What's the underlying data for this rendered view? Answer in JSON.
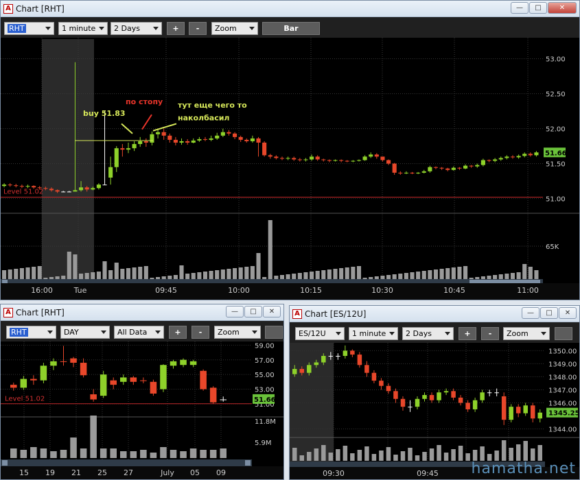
{
  "main": {
    "title": "Chart [RHT]",
    "symbol": "RHT",
    "interval": "1 minute",
    "range": "2 Days",
    "zoom": "Zoom",
    "chart_type_button": "Bar",
    "plus": "+",
    "minus": "-",
    "annotations": {
      "buy": "buy  51.83",
      "stop": "по стопу",
      "note_line1": "тут еще чего то",
      "note_line2": "наколбасил"
    },
    "price_labels": [
      "53.00",
      "52.50",
      "52.00",
      "51.50",
      "51.00"
    ],
    "last_price": "51.66",
    "volume_label": "65K",
    "level_label": "Level 51.02",
    "time_labels": [
      "16:00",
      "Tue",
      "09:45",
      "10:00",
      "10:15",
      "10:30",
      "10:45",
      "11:00"
    ]
  },
  "daily": {
    "title": "Chart [RHT]",
    "symbol": "RHT",
    "interval": "DAY",
    "range": "All Data",
    "zoom": "Zoom",
    "plus": "+",
    "minus": "-",
    "price_labels": [
      "59.00",
      "57.00",
      "55.00",
      "53.00",
      "51.00"
    ],
    "last_price": "51.66",
    "volume_labels": [
      "11.8M",
      "5.9M"
    ],
    "level_label": "Level 51.02",
    "date_labels": [
      "15",
      "19",
      "21",
      "25",
      "27",
      "July",
      "05",
      "09"
    ]
  },
  "es": {
    "title": "Chart [ES/12U]",
    "symbol": "ES/12U",
    "interval": "1 minute",
    "range": "2 Days",
    "zoom": "Zoom",
    "plus": "+",
    "minus": "-",
    "price_labels": [
      "1350.00",
      "1349.00",
      "1348.00",
      "1347.00",
      "1346.00",
      "1344.00"
    ],
    "last_price": "1345.25",
    "time_labels": [
      "09:30",
      "09:45"
    ]
  },
  "watermark": "hamatha.net",
  "chart_data": [
    {
      "type": "candlestick",
      "name": "RHT 1 minute",
      "ylim": [
        50.8,
        53.3
      ],
      "x_labels": [
        "16:00",
        "Tue",
        "09:45",
        "10:00",
        "10:15",
        "10:30",
        "10:45",
        "11:00"
      ],
      "level": 51.02,
      "candles": [
        [
          51.18,
          51.2,
          51.22,
          51.16
        ],
        [
          51.2,
          51.19,
          51.22,
          51.17
        ],
        [
          51.19,
          51.18,
          51.21,
          51.16
        ],
        [
          51.18,
          51.17,
          51.2,
          51.15
        ],
        [
          51.17,
          51.18,
          51.2,
          51.15
        ],
        [
          51.18,
          51.16,
          51.19,
          51.14
        ],
        [
          51.16,
          51.15,
          51.18,
          51.13
        ],
        [
          51.15,
          51.14,
          51.17,
          51.12
        ],
        [
          51.14,
          51.12,
          51.16,
          51.1
        ],
        [
          51.12,
          51.1,
          51.13,
          51.08
        ],
        [
          51.1,
          51.1,
          51.11,
          51.09
        ],
        [
          51.1,
          51.1,
          51.11,
          51.09
        ],
        [
          51.1,
          51.12,
          52.95,
          51.1
        ],
        [
          51.12,
          51.16,
          51.25,
          51.1
        ],
        [
          51.16,
          51.13,
          51.18,
          51.1
        ],
        [
          51.13,
          51.15,
          51.17,
          51.12
        ],
        [
          51.15,
          51.2,
          51.22,
          51.13
        ],
        [
          51.2,
          51.2,
          52.25,
          51.2
        ],
        [
          51.3,
          51.45,
          51.6,
          51.2
        ],
        [
          51.45,
          51.72,
          51.75,
          51.38
        ],
        [
          51.72,
          51.7,
          51.78,
          51.6
        ],
        [
          51.7,
          51.72,
          51.8,
          51.65
        ],
        [
          51.72,
          51.78,
          51.82,
          51.68
        ],
        [
          51.78,
          51.82,
          51.88,
          51.74
        ],
        [
          51.82,
          51.8,
          51.86,
          51.74
        ],
        [
          51.8,
          51.92,
          51.96,
          51.76
        ],
        [
          51.92,
          51.95,
          52.0,
          51.86
        ],
        [
          51.95,
          51.9,
          52.0,
          51.84
        ],
        [
          51.9,
          51.84,
          51.93,
          51.8
        ],
        [
          51.84,
          51.8,
          51.88,
          51.76
        ],
        [
          51.8,
          51.82,
          51.86,
          51.77
        ],
        [
          51.82,
          51.8,
          51.85,
          51.77
        ],
        [
          51.8,
          51.83,
          51.86,
          51.79
        ],
        [
          51.83,
          51.85,
          51.88,
          51.81
        ],
        [
          51.85,
          51.84,
          51.88,
          51.82
        ],
        [
          51.84,
          51.86,
          51.9,
          51.82
        ],
        [
          51.86,
          51.9,
          51.94,
          51.84
        ],
        [
          51.9,
          51.95,
          52.0,
          51.88
        ],
        [
          51.95,
          51.93,
          51.98,
          51.9
        ],
        [
          51.93,
          51.88,
          51.95,
          51.85
        ],
        [
          51.88,
          51.84,
          51.9,
          51.81
        ],
        [
          51.84,
          51.82,
          51.86,
          51.8
        ],
        [
          51.82,
          51.86,
          51.9,
          51.8
        ],
        [
          51.86,
          51.8,
          51.88,
          51.6
        ],
        [
          51.8,
          51.62,
          51.82,
          51.6
        ],
        [
          51.62,
          51.6,
          51.64,
          51.57
        ],
        [
          51.6,
          51.58,
          51.62,
          51.56
        ],
        [
          51.58,
          51.57,
          51.6,
          51.55
        ],
        [
          51.57,
          51.58,
          51.6,
          51.55
        ],
        [
          51.58,
          51.56,
          51.6,
          51.54
        ],
        [
          51.56,
          51.55,
          51.58,
          51.53
        ],
        [
          51.55,
          51.56,
          51.58,
          51.53
        ],
        [
          51.56,
          51.6,
          51.63,
          51.54
        ],
        [
          51.6,
          51.56,
          51.62,
          51.54
        ],
        [
          51.56,
          51.55,
          51.57,
          51.53
        ],
        [
          51.55,
          51.54,
          51.56,
          51.52
        ],
        [
          51.54,
          51.55,
          51.56,
          51.53
        ],
        [
          51.55,
          51.54,
          51.56,
          51.52
        ],
        [
          51.54,
          51.53,
          51.55,
          51.52
        ],
        [
          51.53,
          51.54,
          51.55,
          51.52
        ],
        [
          51.54,
          51.55,
          51.56,
          51.53
        ],
        [
          51.55,
          51.6,
          51.62,
          51.54
        ],
        [
          51.6,
          51.63,
          51.66,
          51.58
        ],
        [
          51.63,
          51.6,
          51.65,
          51.57
        ],
        [
          51.6,
          51.55,
          51.6,
          51.53
        ],
        [
          51.55,
          51.5,
          51.56,
          51.48
        ],
        [
          51.5,
          51.37,
          51.51,
          51.34
        ],
        [
          51.37,
          51.36,
          51.39,
          51.34
        ],
        [
          51.36,
          51.37,
          51.39,
          51.35
        ],
        [
          51.37,
          51.36,
          51.38,
          51.35
        ],
        [
          51.36,
          51.37,
          51.38,
          51.35
        ],
        [
          51.37,
          51.39,
          51.41,
          51.36
        ],
        [
          51.39,
          51.45,
          51.47,
          51.37
        ],
        [
          51.45,
          51.44,
          51.46,
          51.42
        ],
        [
          51.44,
          51.43,
          51.45,
          51.41
        ],
        [
          51.43,
          51.41,
          51.44,
          51.39
        ],
        [
          51.41,
          51.44,
          51.46,
          51.4
        ],
        [
          51.44,
          51.43,
          51.45,
          51.41
        ],
        [
          51.43,
          51.47,
          51.49,
          51.42
        ],
        [
          51.47,
          51.46,
          51.48,
          51.44
        ],
        [
          51.46,
          51.48,
          51.5,
          51.44
        ],
        [
          51.48,
          51.55,
          51.57,
          51.46
        ],
        [
          51.55,
          51.54,
          51.56,
          51.52
        ],
        [
          51.54,
          51.56,
          51.58,
          51.52
        ],
        [
          51.56,
          51.58,
          51.6,
          51.54
        ],
        [
          51.58,
          51.6,
          51.62,
          51.56
        ],
        [
          51.6,
          51.59,
          51.62,
          51.57
        ],
        [
          51.59,
          51.61,
          51.63,
          51.57
        ],
        [
          51.61,
          51.64,
          51.66,
          51.59
        ],
        [
          51.64,
          51.62,
          51.66,
          51.6
        ],
        [
          51.62,
          51.66,
          51.68,
          51.6
        ]
      ],
      "volume_labels": [
        "65K"
      ]
    },
    {
      "type": "candlestick",
      "name": "RHT DAY",
      "ylim": [
        49.5,
        59.5
      ],
      "x_labels": [
        "15",
        "19",
        "21",
        "25",
        "27",
        "July",
        "05",
        "09"
      ],
      "level": 51.02,
      "candles": [
        [
          53.6,
          53.2,
          53.9,
          52.8
        ],
        [
          53.2,
          54.4,
          54.8,
          52.9
        ],
        [
          54.4,
          54.2,
          54.9,
          53.6
        ],
        [
          54.2,
          56.2,
          56.6,
          53.8
        ],
        [
          56.2,
          56.8,
          57.2,
          55.6
        ],
        [
          56.8,
          56.7,
          58.9,
          56.2
        ],
        [
          57.2,
          56.6,
          57.4,
          56.0
        ],
        [
          56.6,
          54.9,
          57.2,
          54.6
        ],
        [
          52.3,
          51.6,
          53.0,
          51.3
        ],
        [
          52.1,
          55.0,
          55.5,
          51.8
        ],
        [
          54.2,
          53.6,
          54.6,
          53.0
        ],
        [
          54.0,
          54.6,
          55.0,
          53.6
        ],
        [
          54.6,
          54.0,
          54.8,
          53.6
        ],
        [
          54.2,
          54.1,
          54.6,
          53.8
        ],
        [
          54.0,
          52.4,
          54.3,
          52.1
        ],
        [
          53.0,
          56.3,
          56.4,
          52.6
        ],
        [
          56.2,
          56.8,
          57.0,
          55.8
        ],
        [
          56.3,
          57.0,
          57.2,
          56.0
        ],
        [
          56.3,
          56.8,
          57.0,
          56.0
        ],
        [
          55.5,
          53.0,
          55.7,
          52.8
        ],
        [
          53.2,
          51.2,
          53.4,
          51.0
        ],
        [
          51.6,
          51.6,
          52.0,
          51.3
        ]
      ],
      "volume_labels": [
        "11.8M",
        "5.9M"
      ]
    },
    {
      "type": "candlestick",
      "name": "ES/12U 1 minute",
      "ylim": [
        1343.5,
        1350.6
      ],
      "x_labels": [
        "09:30",
        "09:45"
      ],
      "candles": [
        [
          1348.2,
          1348.6,
          1348.9,
          1348.0
        ],
        [
          1348.6,
          1348.3,
          1348.8,
          1348.1
        ],
        [
          1348.3,
          1348.9,
          1349.1,
          1348.1
        ],
        [
          1348.9,
          1349.1,
          1349.3,
          1348.7
        ],
        [
          1349.1,
          1349.6,
          1349.8,
          1348.9
        ],
        [
          1349.6,
          1349.6,
          1349.9,
          1349.3
        ],
        [
          1349.6,
          1349.6,
          1349.8,
          1349.3
        ],
        [
          1349.6,
          1350.0,
          1350.4,
          1349.4
        ],
        [
          1350.0,
          1349.7,
          1350.1,
          1349.5
        ],
        [
          1349.7,
          1348.9,
          1349.9,
          1348.7
        ],
        [
          1348.9,
          1348.3,
          1349.2,
          1348.0
        ],
        [
          1348.3,
          1347.7,
          1348.5,
          1347.5
        ],
        [
          1347.7,
          1347.3,
          1347.9,
          1347.0
        ],
        [
          1347.3,
          1346.9,
          1347.5,
          1346.7
        ],
        [
          1346.9,
          1346.3,
          1347.1,
          1346.0
        ],
        [
          1346.3,
          1345.7,
          1346.5,
          1345.4
        ],
        [
          1345.7,
          1345.7,
          1346.2,
          1345.3
        ],
        [
          1345.7,
          1346.3,
          1346.5,
          1345.5
        ],
        [
          1346.3,
          1346.6,
          1346.8,
          1346.1
        ],
        [
          1346.6,
          1346.2,
          1346.8,
          1346.0
        ],
        [
          1346.2,
          1346.8,
          1347.0,
          1346.0
        ],
        [
          1346.8,
          1346.9,
          1347.1,
          1346.6
        ],
        [
          1346.9,
          1346.4,
          1347.1,
          1346.2
        ],
        [
          1346.4,
          1346.0,
          1346.6,
          1345.8
        ],
        [
          1346.0,
          1345.5,
          1346.2,
          1345.3
        ],
        [
          1345.5,
          1346.2,
          1346.4,
          1345.3
        ],
        [
          1346.2,
          1346.8,
          1347.0,
          1346.0
        ],
        [
          1346.8,
          1346.8,
          1347.0,
          1346.5
        ],
        [
          1346.8,
          1346.8,
          1347.1,
          1346.5
        ],
        [
          1346.5,
          1344.7,
          1346.8,
          1344.3
        ],
        [
          1344.7,
          1345.7,
          1345.9,
          1344.5
        ],
        [
          1345.7,
          1345.2,
          1345.9,
          1344.9
        ],
        [
          1345.2,
          1345.8,
          1346.0,
          1345.0
        ],
        [
          1345.8,
          1344.8,
          1346.0,
          1344.5
        ],
        [
          1344.8,
          1345.25,
          1345.5,
          1344.5
        ]
      ]
    }
  ]
}
